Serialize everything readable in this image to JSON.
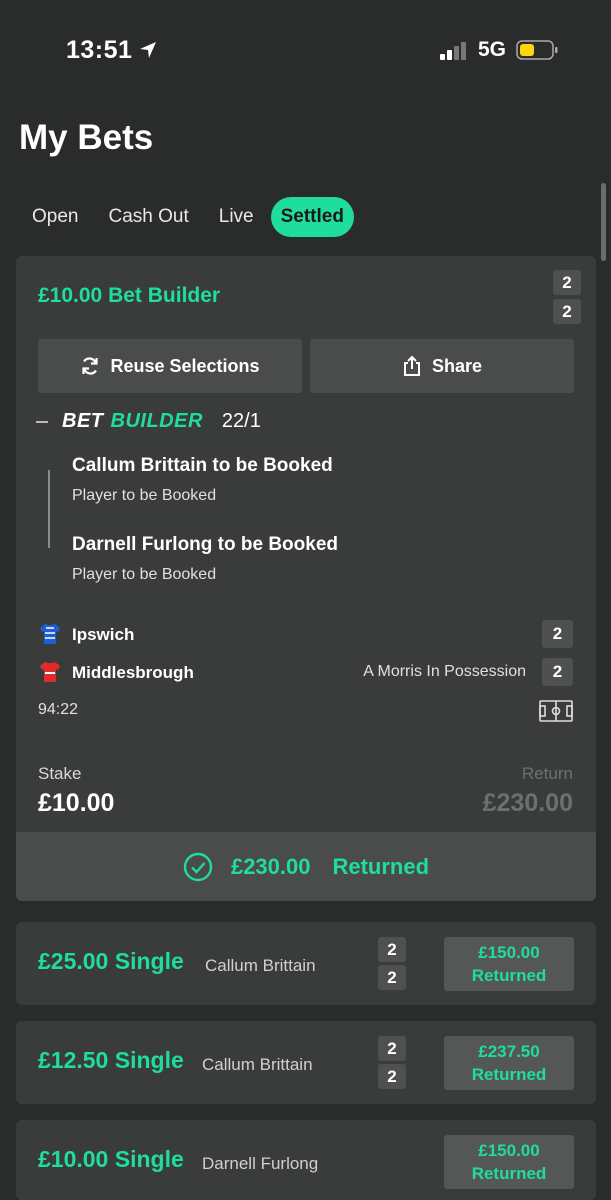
{
  "status_bar": {
    "time": "13:51",
    "network": "5G"
  },
  "page_title": "My Bets",
  "tabs": [
    {
      "label": "Open"
    },
    {
      "label": "Cash Out"
    },
    {
      "label": "Live"
    },
    {
      "label": "Settled",
      "active": true
    }
  ],
  "colors": {
    "accent": "#1fdc9f",
    "background": "#2a2c2b",
    "card": "#3a3c3b"
  },
  "main_bet": {
    "title": "£10.00 Bet Builder",
    "badge_top": "2",
    "badge_bottom": "2",
    "reuse_label": "Reuse Selections",
    "share_label": "Share",
    "builder_bet": "BET",
    "builder_builder": "BUILDER",
    "odds": "22/1",
    "selections": [
      {
        "name": "Callum Brittain to be Booked",
        "type": "Player to be Booked"
      },
      {
        "name": "Darnell Furlong to be Booked",
        "type": "Player to be Booked"
      }
    ],
    "home_team": "Ipswich",
    "home_score": "2",
    "away_team": "Middlesbrough",
    "away_score": "2",
    "possession": "A Morris In Possession",
    "match_clock": "94:22",
    "stake_label": "Stake",
    "stake_value": "£10.00",
    "return_label": "Return",
    "return_value": "£230.00",
    "returned_amount": "£230.00",
    "returned_label": "Returned"
  },
  "singles": [
    {
      "title": "£25.00 Single",
      "player": "Callum Brittain",
      "score_top": "2",
      "score_bottom": "2",
      "return_amount": "£150.00",
      "return_label": "Returned"
    },
    {
      "title": "£12.50 Single",
      "player": "Callum Brittain",
      "score_top": "2",
      "score_bottom": "2",
      "return_amount": "£237.50",
      "return_label": "Returned"
    },
    {
      "title": "£10.00 Single",
      "player": "Darnell Furlong",
      "return_amount": "£150.00",
      "return_label": "Returned"
    }
  ]
}
